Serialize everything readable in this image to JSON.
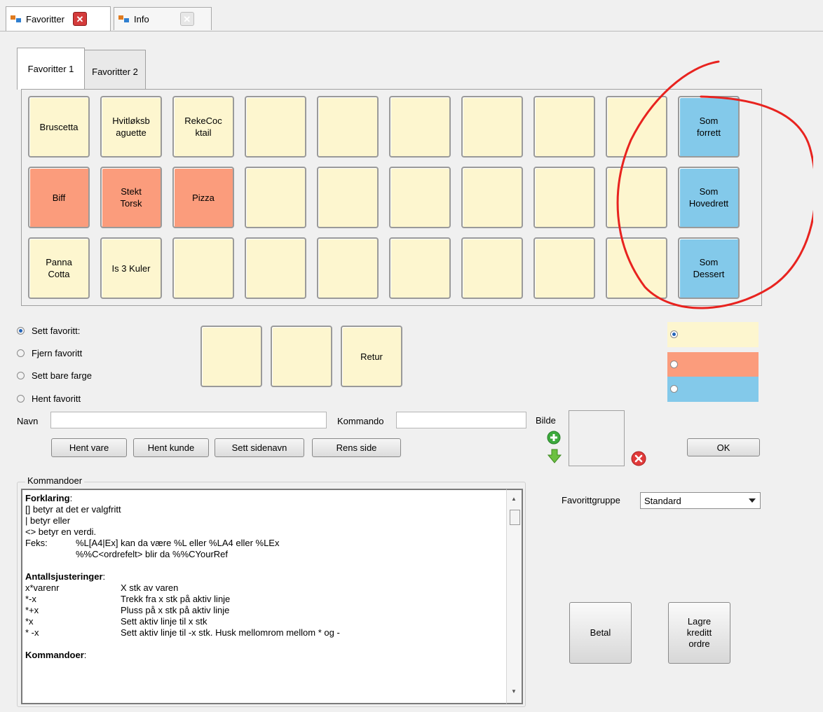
{
  "doc_tabs": [
    {
      "label": "Favoritter",
      "active": true
    },
    {
      "label": "Info",
      "active": false
    }
  ],
  "inner_tabs": [
    "Favoritter 1",
    "Favoritter 2"
  ],
  "tiles": [
    [
      "Bruscetta",
      "Hvitløksb\naguette",
      "RekeCoc\nktail",
      "",
      "",
      "",
      "",
      "",
      "",
      "Som\nforrett"
    ],
    [
      "Biff",
      "Stekt\nTorsk",
      "Pizza",
      "",
      "",
      "",
      "",
      "",
      "",
      "Som\nHovedrett"
    ],
    [
      "Panna\nCotta",
      "Is 3 Kuler",
      "",
      "",
      "",
      "",
      "",
      "",
      "",
      "Som\nDessert"
    ]
  ],
  "tile_colors": {
    "default": "#fdf6cf",
    "salmon": "#fb9c7c",
    "blue": "#83c9ea"
  },
  "mode_options": [
    {
      "label": "Sett favoritt:",
      "checked": true
    },
    {
      "label": "Fjern favoritt",
      "checked": false
    },
    {
      "label": "Sett bare farge",
      "checked": false
    },
    {
      "label": "Hent favoritt",
      "checked": false
    }
  ],
  "preview_tiles": [
    "",
    "",
    "Retur"
  ],
  "color_options": [
    {
      "color": "#fdf6cf",
      "checked": true
    },
    {
      "color": "#fb9c7c",
      "checked": false
    },
    {
      "color": "#83c9ea",
      "checked": false
    }
  ],
  "form": {
    "name_label": "Navn",
    "name_value": "",
    "command_label": "Kommando",
    "command_value": "",
    "image_label": "Bilde"
  },
  "actions": {
    "hent_vare": "Hent vare",
    "hent_kunde": "Hent kunde",
    "sett_sidenavn": "Sett sidenavn",
    "rens_side": "Rens side",
    "ok": "OK"
  },
  "commands": {
    "group_label": "Kommandoer",
    "heading1": "Forklaring",
    "lines1": [
      "[] betyr at det er valgfritt",
      "| betyr eller",
      "<> betyr en verdi."
    ],
    "example_label": "Feks:",
    "example1": "%L[A4|Ex] kan da være %L eller %LA4 eller %LEx",
    "example2": "%%C<ordrefelt> blir da %%CYourRef",
    "heading2": "Antallsjusteringer",
    "adjustments": [
      {
        "k": "x*varenr",
        "v": "X stk av varen"
      },
      {
        "k": "*-x",
        "v": "Trekk fra x stk på aktiv linje"
      },
      {
        "k": "*+x",
        "v": "Pluss på x stk på aktiv linje"
      },
      {
        "k": "*x",
        "v": "Sett aktiv linje til x stk"
      },
      {
        "k": "* -x",
        "v": "Sett aktiv linje til -x stk. Husk mellomrom mellom * og -"
      }
    ],
    "heading3": "Kommandoer"
  },
  "group_selector": {
    "label": "Favorittgruppe",
    "value": "Standard"
  },
  "bottom_buttons": {
    "betal": "Betal",
    "lagre": "Lagre\nkreditt\nordre"
  }
}
